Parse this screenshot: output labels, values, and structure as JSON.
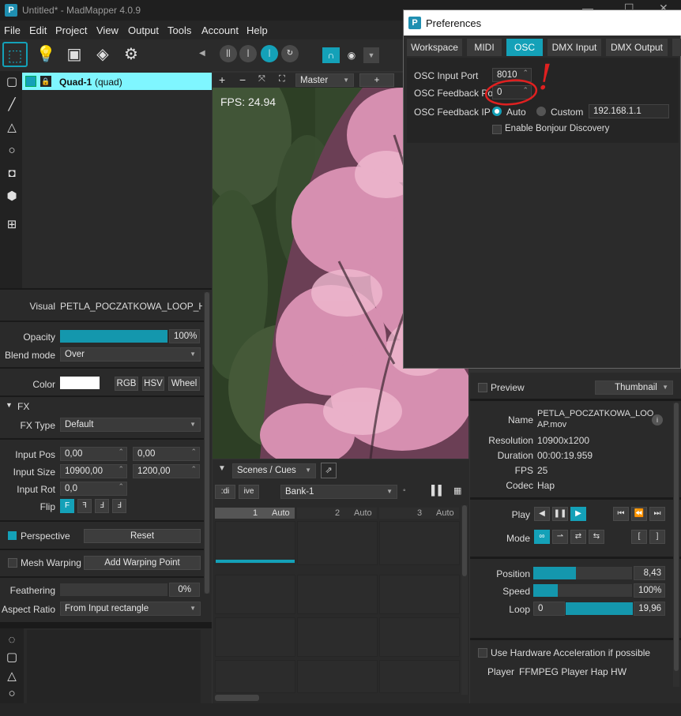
{
  "window": {
    "title": "Untitled* - MadMapper 4.0.9"
  },
  "menu": [
    "File",
    "Edit",
    "Project",
    "View",
    "Output",
    "Tools",
    "Account",
    "Help"
  ],
  "toolbar": {
    "play_modes": [
      "||",
      "|",
      "|"
    ],
    "master_label": "Master",
    "plus": "+"
  },
  "surface_list": {
    "item_name": "Quad-1",
    "item_type": "(quad)"
  },
  "viewport": {
    "fps": "FPS: 24.94"
  },
  "properties": {
    "visual_label": "Visual",
    "visual_value": "PETLA_POCZATKOWA_LOOP_HAP.m",
    "opacity_label": "Opacity",
    "opacity_value": "100%",
    "opacity_fraction": 1.0,
    "blend_label": "Blend mode",
    "blend_value": "Over",
    "color_label": "Color",
    "color_swatch": "#ffffff",
    "rgb": "RGB",
    "hsv": "HSV",
    "wheel": "Wheel",
    "fx_header": "FX",
    "fx_type_label": "FX Type",
    "fx_type_value": "Default",
    "input_pos_label": "Input Pos",
    "input_pos_x": "0,00",
    "input_pos_y": "0,00",
    "input_size_label": "Input Size",
    "input_size_w": "10900,00",
    "input_size_h": "1200,00",
    "input_rot_label": "Input Rot",
    "input_rot_value": "0,0",
    "flip_label": "Flip",
    "perspective_label": "Perspective",
    "reset_label": "Reset",
    "mesh_label": "Mesh Warping",
    "add_warp_label": "Add Warping Point",
    "feathering_label": "Feathering",
    "feathering_value": "0%",
    "aspect_label": "Aspect Ratio",
    "aspect_value": "From Input rectangle"
  },
  "scenes": {
    "dropdown": "Scenes / Cues",
    "tab1": ":di",
    "tab2": "ive",
    "bank": "Bank-1",
    "cols": [
      {
        "num": "1",
        "mode": "Auto"
      },
      {
        "num": "2",
        "mode": "Auto"
      },
      {
        "num": "3",
        "mode": "Auto"
      }
    ]
  },
  "media": {
    "preview_label": "Preview",
    "thumb_mode": "Thumbnail",
    "name_label": "Name",
    "name_value_1": "PETLA_POCZATKOWA_LOO",
    "name_value_2": "AP.mov",
    "resolution_label": "Resolution",
    "resolution_value": "10900x1200",
    "duration_label": "Duration",
    "duration_value": "00:00:19.959",
    "fps_label": "FPS",
    "fps_value": "25",
    "codec_label": "Codec",
    "codec_value": "Hap",
    "play_label": "Play",
    "mode_label": "Mode",
    "position_label": "Position",
    "position_value": "8,43",
    "position_fraction": 0.43,
    "speed_label": "Speed",
    "speed_value": "100%",
    "speed_fraction": 0.25,
    "loop_label": "Loop",
    "loop_start": "0",
    "loop_end": "19,96",
    "hw_label": "Use Hardware Acceleration if possible",
    "player_label": "Player",
    "player_value": "FFMPEG Player Hap HW"
  },
  "preferences": {
    "title": "Preferences",
    "tabs": [
      "Workspace",
      "MIDI",
      "OSC",
      "DMX Input",
      "DMX Output"
    ],
    "active_tab": "OSC",
    "osc_input_port_label": "OSC Input Port",
    "osc_input_port_value": "8010",
    "osc_feedback_port_label": "OSC Feedback Port",
    "osc_feedback_port_value": "0",
    "osc_feedback_ip_label": "OSC Feedback IP",
    "auto_label": "Auto",
    "custom_label": "Custom",
    "ip_value": "192.168.1.1",
    "bonjour_label": "Enable Bonjour Discovery",
    "annotation_mark": "!",
    "annotation_color": "#e02020"
  },
  "colors": {
    "accent": "#14a1b8",
    "surface_highlight": "#7ff6ff"
  }
}
